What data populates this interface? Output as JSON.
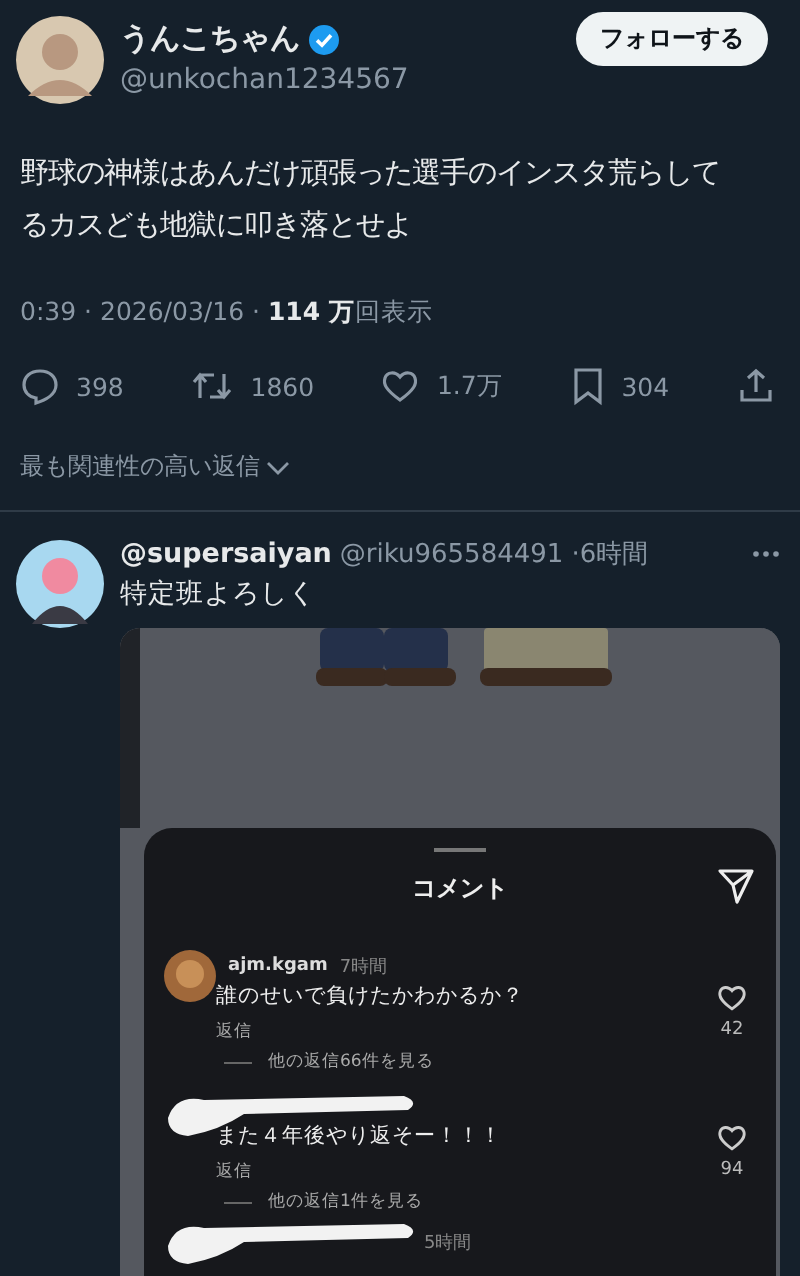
{
  "author": {
    "name": "うんこちゃん",
    "verified": true,
    "handle": "@unkochan1234567"
  },
  "follow_button": "フォローする",
  "text": "野球の神様はあんだけ頑張った選手のインスタ荒らしてるカスども地獄に叩き落とせよ",
  "meta": "0:39 · 2026/03/16 · **114 万**回表示",
  "actions": [
    {
      "kind": "reply",
      "count": "398"
    },
    {
      "kind": "repost",
      "count": "1860"
    },
    {
      "kind": "like",
      "count": "1.7万"
    },
    {
      "kind": "bookmark",
      "count": "304"
    },
    {
      "kind": "share"
    }
  ],
  "sort_label": "最も関連性の高い返信",
  "reply": {
    "name": "@supersaiyan",
    "handle": "@riku965584491",
    "time": "·6時間",
    "text": "特定班よろしく",
    "attachment": {
      "title": "コメント",
      "comments": [
        {
          "redacted": false,
          "user": "ajm.kgam",
          "time": "7時間",
          "text": "誰のせいで負けたかわかるか？",
          "reply_label": "返信",
          "more": "他の返信66件を見る",
          "likes": "42"
        },
        {
          "redacted": true,
          "text": "また４年後やり返そー！！！",
          "reply_label": "返信",
          "more": "他の返信1件を見る",
          "likes": "94"
        },
        {
          "redacted": true,
          "time": "5時間"
        }
      ]
    }
  }
}
